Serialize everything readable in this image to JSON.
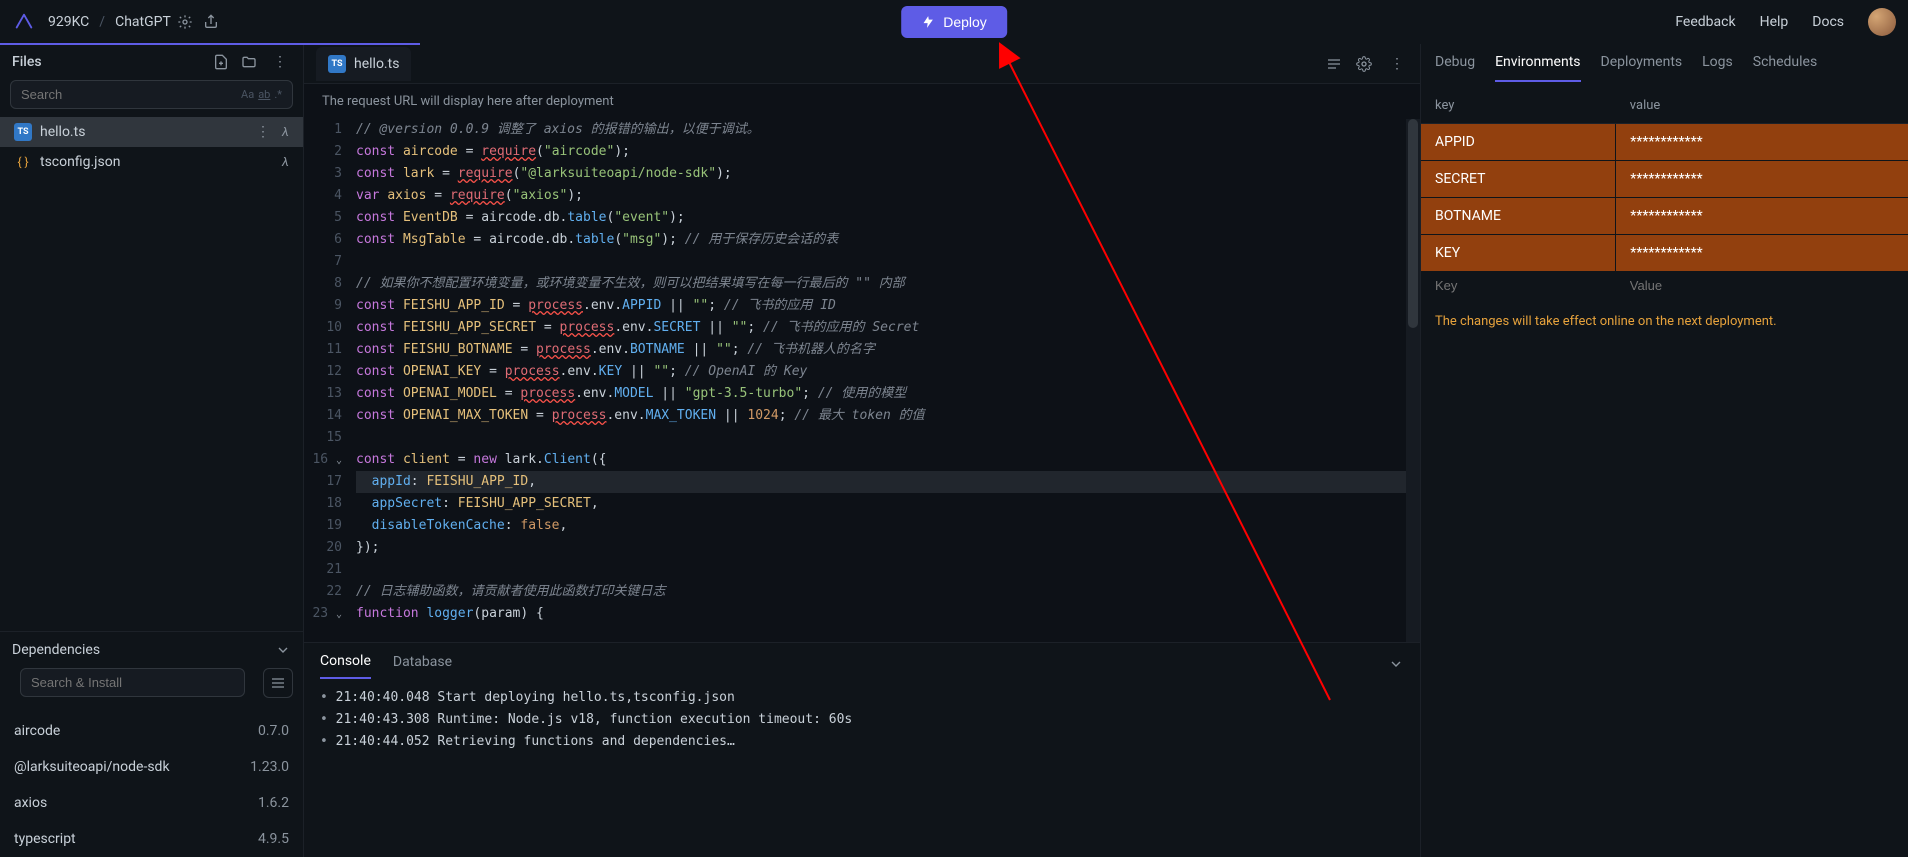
{
  "topbar": {
    "breadcrumb1": "929KC",
    "breadcrumb2": "ChatGPT",
    "deploy_label": "Deploy",
    "feedback": "Feedback",
    "help": "Help",
    "docs": "Docs"
  },
  "files": {
    "title": "Files",
    "search_placeholder": "Search",
    "search_hint_aa": "Aa",
    "search_hint_ab": "ab",
    "search_hint_regex": ".*",
    "items": [
      {
        "name": "hello.ts",
        "type": "ts",
        "active": true
      },
      {
        "name": "tsconfig.json",
        "type": "json",
        "active": false
      }
    ]
  },
  "deps": {
    "title": "Dependencies",
    "search_placeholder": "Search & Install",
    "items": [
      {
        "name": "aircode",
        "version": "0.7.0"
      },
      {
        "name": "@larksuiteoapi/node-sdk",
        "version": "1.23.0"
      },
      {
        "name": "axios",
        "version": "1.6.2"
      },
      {
        "name": "typescript",
        "version": "4.9.5"
      }
    ]
  },
  "editor": {
    "filename": "hello.ts",
    "url_hint": "The request URL will display here after deployment",
    "lines": [
      {
        "n": 1,
        "html": "<span class='cm'>// @version 0.0.9 调整了 axios 的报错的输出，以便于调试。</span>"
      },
      {
        "n": 2,
        "html": "<span class='kw'>const</span> <span class='var'>aircode</span> <span class='op'>=</span> <span class='fn err'>require</span>(<span class='str'>\"aircode\"</span>);"
      },
      {
        "n": 3,
        "html": "<span class='kw'>const</span> <span class='var'>lark</span> <span class='op'>=</span> <span class='fn err'>require</span>(<span class='str'>\"@larksuiteoapi/node-sdk\"</span>);"
      },
      {
        "n": 4,
        "html": "<span class='kw'>var</span> <span class='var'>axios</span> <span class='op'>=</span> <span class='fn err'>require</span>(<span class='str'>\"axios\"</span>);"
      },
      {
        "n": 5,
        "html": "<span class='kw'>const</span> <span class='var'>EventDB</span> <span class='op'>=</span> aircode.db.<span class='prop'>table</span>(<span class='str'>\"event\"</span>);"
      },
      {
        "n": 6,
        "html": "<span class='kw'>const</span> <span class='var'>MsgTable</span> <span class='op'>=</span> aircode.db.<span class='prop'>table</span>(<span class='str'>\"msg\"</span>); <span class='cm'>// 用于保存历史会话的表</span>"
      },
      {
        "n": 7,
        "html": ""
      },
      {
        "n": 8,
        "html": "<span class='cm'>// 如果你不想配置环境变量，或环境变量不生效，则可以把结果填写在每一行最后的 \"\" 内部</span>"
      },
      {
        "n": 9,
        "html": "<span class='kw'>const</span> <span class='var'>FEISHU_APP_ID</span> <span class='op'>=</span> <span class='fn err'>process</span>.env.<span class='prop'>APPID</span> <span class='op'>||</span> <span class='str'>\"\"</span>; <span class='cm'>// 飞书的应用 ID</span>"
      },
      {
        "n": 10,
        "html": "<span class='kw'>const</span> <span class='var'>FEISHU_APP_SECRET</span> <span class='op'>=</span> <span class='fn err'>process</span>.env.<span class='prop'>SECRET</span> <span class='op'>||</span> <span class='str'>\"\"</span>; <span class='cm'>// 飞书的应用的 Secret</span>"
      },
      {
        "n": 11,
        "html": "<span class='kw'>const</span> <span class='var'>FEISHU_BOTNAME</span> <span class='op'>=</span> <span class='fn err'>process</span>.env.<span class='prop'>BOTNAME</span> <span class='op'>||</span> <span class='str'>\"\"</span>; <span class='cm'>// 飞书机器人的名字</span>"
      },
      {
        "n": 12,
        "html": "<span class='kw'>const</span> <span class='var'>OPENAI_KEY</span> <span class='op'>=</span> <span class='fn err'>process</span>.env.<span class='prop'>KEY</span> <span class='op'>||</span> <span class='str'>\"\"</span>; <span class='cm'>// OpenAI 的 Key</span>"
      },
      {
        "n": 13,
        "html": "<span class='kw'>const</span> <span class='var'>OPENAI_MODEL</span> <span class='op'>=</span> <span class='fn err'>process</span>.env.<span class='prop'>MODEL</span> <span class='op'>||</span> <span class='str'>\"gpt-3.5-turbo\"</span>; <span class='cm'>// 使用的模型</span>"
      },
      {
        "n": 14,
        "html": "<span class='kw'>const</span> <span class='var'>OPENAI_MAX_TOKEN</span> <span class='op'>=</span> <span class='fn err'>process</span>.env.<span class='prop'>MAX_TOKEN</span> <span class='op'>||</span> <span class='num'>1024</span>; <span class='cm'>// 最大 token 的值</span>"
      },
      {
        "n": 15,
        "html": ""
      },
      {
        "n": 16,
        "html": "<span class='kw'>const</span> <span class='var'>client</span> <span class='op'>=</span> <span class='kw'>new</span> lark.<span class='prop'>Client</span>({",
        "fold": true
      },
      {
        "n": 17,
        "html": "  <span class='prop'>appId</span>: <span class='var'>FEISHU_APP_ID</span>,",
        "hl": true
      },
      {
        "n": 18,
        "html": "  <span class='prop'>appSecret</span>: <span class='var'>FEISHU_APP_SECRET</span>,"
      },
      {
        "n": 19,
        "html": "  <span class='prop'>disableTokenCache</span>: <span class='num'>false</span>,"
      },
      {
        "n": 20,
        "html": "});"
      },
      {
        "n": 21,
        "html": ""
      },
      {
        "n": 22,
        "html": "<span class='cm'>// 日志辅助函数，请贡献者使用此函数打印关键日志</span>"
      },
      {
        "n": 23,
        "html": "<span class='kw'>function</span> <span class='prop'>logger</span>(param) {",
        "fold": true
      }
    ]
  },
  "console": {
    "tabs": [
      "Console",
      "Database"
    ],
    "active_tab": 0,
    "logs": [
      "21:40:40.048 Start deploying hello.ts,tsconfig.json",
      "21:40:43.308 Runtime: Node.js v18, function execution timeout: 60s",
      "21:40:44.052 Retrieving functions and dependencies…"
    ]
  },
  "right": {
    "tabs": [
      "Debug",
      "Environments",
      "Deployments",
      "Logs",
      "Schedules"
    ],
    "active_tab": 1,
    "env_header_key": "key",
    "env_header_value": "value",
    "env_rows": [
      {
        "key": "APPID",
        "value": "************"
      },
      {
        "key": "SECRET",
        "value": "************"
      },
      {
        "key": "BOTNAME",
        "value": "************"
      },
      {
        "key": "KEY",
        "value": "************"
      }
    ],
    "key_placeholder": "Key",
    "value_placeholder": "Value",
    "notice": "The changes will take effect online on the next deployment."
  }
}
